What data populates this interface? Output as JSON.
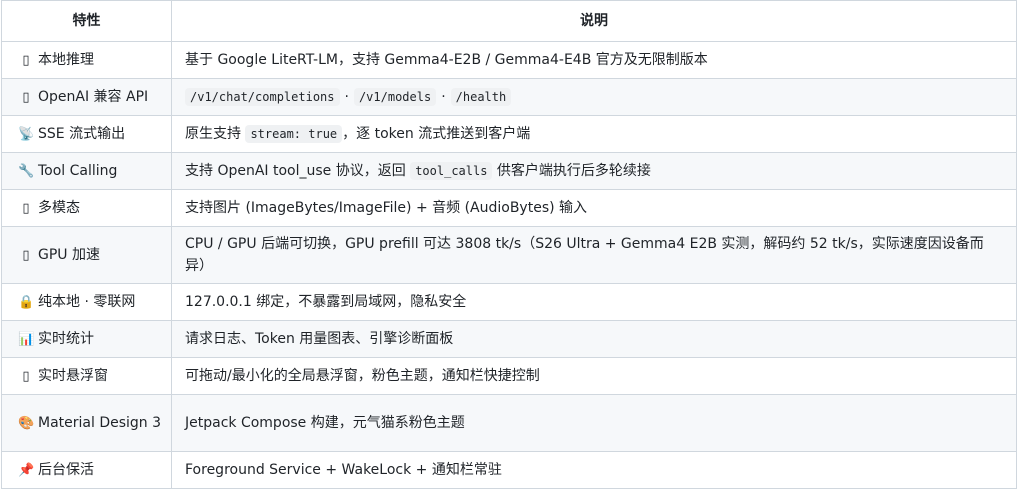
{
  "header": {
    "feature": "特性",
    "description": "说明"
  },
  "rows": [
    {
      "icon": "box-glyph",
      "feature": "本地推理",
      "parts": [
        {
          "t": "基于 Google LiteRT-LM，支持 Gemma4-E2B / Gemma4-E4B 官方及无限制版本"
        }
      ]
    },
    {
      "icon": "box-glyph",
      "feature": "OpenAI 兼容 API",
      "parts": [
        {
          "c": "/v1/chat/completions"
        },
        {
          "s": "·"
        },
        {
          "c": "/v1/models"
        },
        {
          "s": "·"
        },
        {
          "c": "/health"
        }
      ]
    },
    {
      "icon": "broadcast-icon",
      "feature": "SSE 流式输出",
      "parts": [
        {
          "t": "原生支持 "
        },
        {
          "c": "stream: true"
        },
        {
          "t": "，逐 token 流式推送到客户端"
        }
      ]
    },
    {
      "icon": "wrench-icon",
      "feature": "Tool Calling",
      "parts": [
        {
          "t": "支持 OpenAI tool_use 协议，返回 "
        },
        {
          "c": "tool_calls"
        },
        {
          "t": " 供客户端执行后多轮续接"
        }
      ]
    },
    {
      "icon": "box-glyph",
      "feature": "多模态",
      "parts": [
        {
          "t": "支持图片 (ImageBytes/ImageFile) + 音频 (AudioBytes) 输入"
        }
      ]
    },
    {
      "icon": "box-glyph",
      "feature": "GPU 加速",
      "tall": true,
      "parts": [
        {
          "t": "CPU / GPU 后端可切换，GPU prefill 可达 3808 tk/s（S26 Ultra + Gemma4 E2B 实测，解码约 52 tk/s，实际速度因设备而异）"
        }
      ]
    },
    {
      "icon": "lock-icon",
      "feature": "纯本地 · 零联网",
      "parts": [
        {
          "t": "127.0.0.1 绑定，不暴露到局域网，隐私安全"
        }
      ]
    },
    {
      "icon": "bar-chart-icon",
      "feature": "实时统计",
      "parts": [
        {
          "t": "请求日志、Token 用量图表、引擎诊断面板"
        }
      ]
    },
    {
      "icon": "box-glyph",
      "feature": "实时悬浮窗",
      "parts": [
        {
          "t": "可拖动/最小化的全局悬浮窗，粉色主题，通知栏快捷控制"
        }
      ]
    },
    {
      "icon": "palette-icon",
      "feature": "Material Design 3",
      "tall": true,
      "parts": [
        {
          "t": "Jetpack Compose 构建，元气猫系粉色主题"
        }
      ]
    },
    {
      "icon": "pin-icon",
      "feature": "后台保活",
      "parts": [
        {
          "t": "Foreground Service + WakeLock + 通知栏常驻"
        }
      ]
    }
  ],
  "glyphs": {
    "box-glyph": "▯",
    "broadcast-icon": "📡",
    "wrench-icon": "🔧",
    "lock-icon": "🔒",
    "bar-chart-icon": "📊",
    "palette-icon": "🎨",
    "pin-icon": "📌"
  }
}
